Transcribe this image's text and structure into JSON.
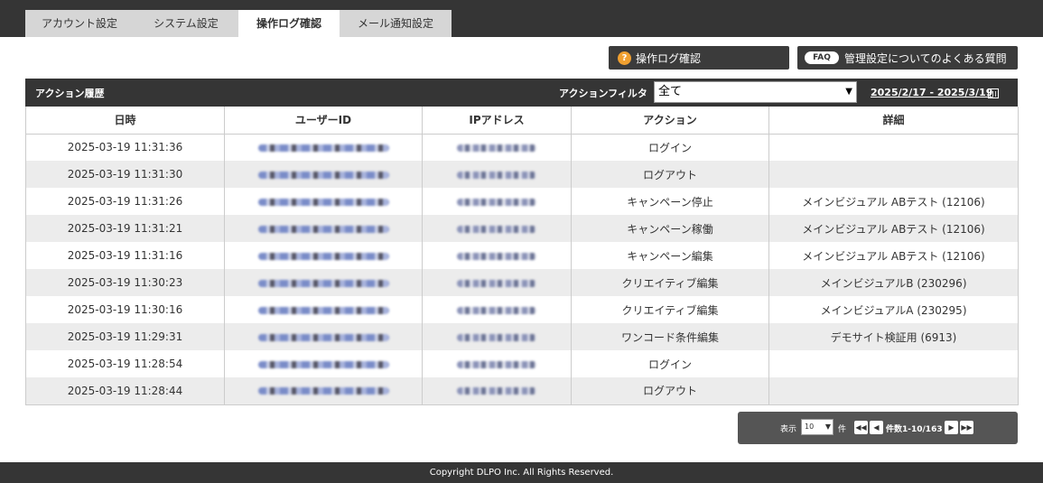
{
  "tabs": [
    {
      "label": "アカウント設定"
    },
    {
      "label": "システム設定"
    },
    {
      "label": "操作ログ確認",
      "active": true
    },
    {
      "label": "メール通知設定"
    }
  ],
  "buttons": {
    "log_label": "操作ログ確認",
    "log_icon": "?",
    "faq_badge": "FAQ",
    "faq_label": "管理設定についてのよくある質問"
  },
  "section": {
    "title": "アクション履歴",
    "filter_label": "アクションフィルタ",
    "filter_value": "全て",
    "date_range": "2025/2/17 - 2025/3/19"
  },
  "table": {
    "headers": [
      "日時",
      "ユーザーID",
      "IPアドレス",
      "アクション",
      "詳細"
    ],
    "rows": [
      {
        "datetime": "2025-03-19 11:31:36",
        "action": "ログイン",
        "detail": ""
      },
      {
        "datetime": "2025-03-19 11:31:30",
        "action": "ログアウト",
        "detail": ""
      },
      {
        "datetime": "2025-03-19 11:31:26",
        "action": "キャンペーン停止",
        "detail": "メインビジュアル ABテスト (12106)"
      },
      {
        "datetime": "2025-03-19 11:31:21",
        "action": "キャンペーン稼働",
        "detail": "メインビジュアル ABテスト (12106)"
      },
      {
        "datetime": "2025-03-19 11:31:16",
        "action": "キャンペーン編集",
        "detail": "メインビジュアル ABテスト (12106)"
      },
      {
        "datetime": "2025-03-19 11:30:23",
        "action": "クリエイティブ編集",
        "detail": "メインビジュアルB (230296)"
      },
      {
        "datetime": "2025-03-19 11:30:16",
        "action": "クリエイティブ編集",
        "detail": "メインビジュアルA (230295)"
      },
      {
        "datetime": "2025-03-19 11:29:31",
        "action": "ワンコード条件編集",
        "detail": "デモサイト検証用 (6913)"
      },
      {
        "datetime": "2025-03-19 11:28:54",
        "action": "ログイン",
        "detail": ""
      },
      {
        "datetime": "2025-03-19 11:28:44",
        "action": "ログアウト",
        "detail": ""
      }
    ]
  },
  "pager": {
    "show_label": "表示",
    "per_page": "10",
    "unit_label": "件",
    "count_text": "件数1-10/163"
  },
  "footer": {
    "copyright": "Copyright DLPO Inc. All Rights Reserved."
  }
}
